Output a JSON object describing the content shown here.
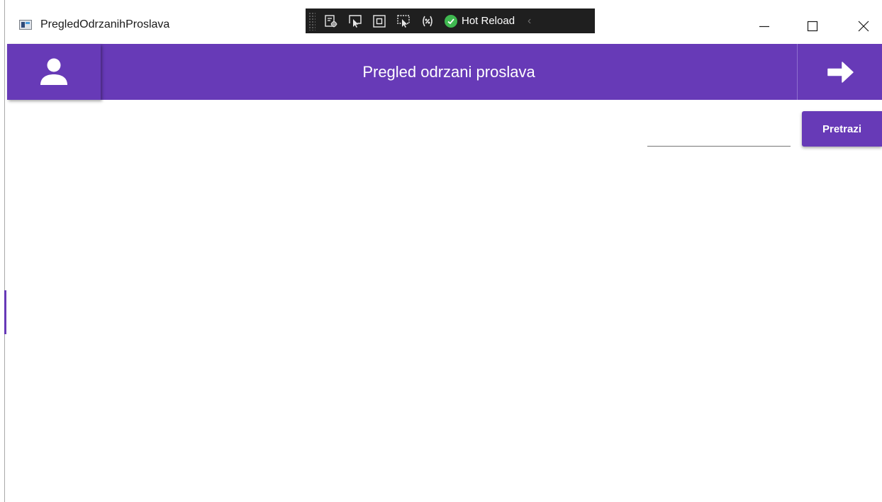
{
  "window": {
    "title": "PregledOdrzanihProslava",
    "icon": "app-window-icon",
    "controls": [
      "minimize-icon",
      "maximize-icon",
      "close-icon"
    ]
  },
  "debug_toolbar": {
    "tools": [
      "live-visual-tree-icon",
      "select-element-icon",
      "display-layout-adorners-icon",
      "track-focus-icon",
      "binding-failures-icon"
    ],
    "hot_reload_label": "Hot Reload",
    "hot_reload_icon": "check-circle-icon",
    "collapse_icon": "chevron-left-icon"
  },
  "header": {
    "title": "Pregled odrzani proslava",
    "user_icon": "user-icon",
    "next_icon": "arrow-right-icon"
  },
  "search": {
    "value": "",
    "button_label": "Pretrazi"
  },
  "colors": {
    "primary": "#673ab7",
    "header_text": "#ffffff",
    "hot_reload_ok": "#3fb950",
    "debug_toolbar_bg": "#1f1f1f"
  }
}
